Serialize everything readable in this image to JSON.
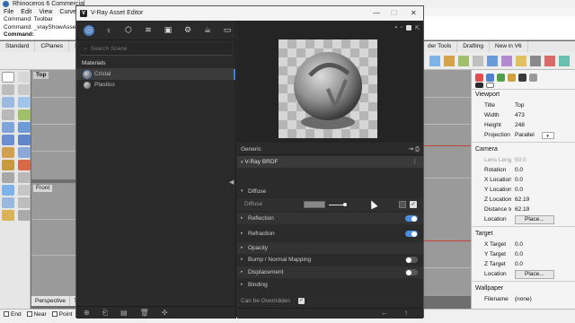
{
  "rhino": {
    "title": "Rhinoceros 6 Commercial",
    "menu": [
      "File",
      "Edit",
      "View",
      "Curve"
    ],
    "commands": [
      "Command: Toolbar",
      "Command: _vrayShowAsset",
      "Command:"
    ],
    "tabs": [
      "Standard",
      "CPlanes",
      "Se"
    ],
    "tabs_right": [
      "der Tools",
      "Drafting",
      "New in V6"
    ],
    "viewport_top": "Top",
    "viewport_front": "Front",
    "viewport_tabs": [
      "Perspective",
      "To"
    ],
    "osnap": [
      "End",
      "Near",
      "Point"
    ]
  },
  "properties": {
    "viewport_section": "Viewport",
    "viewport_rows": [
      {
        "k": "Title",
        "v": "Top"
      },
      {
        "k": "Width",
        "v": "473"
      },
      {
        "k": "Height",
        "v": "248"
      },
      {
        "k": "Projection",
        "v": "Parallel"
      }
    ],
    "camera_section": "Camera",
    "camera_rows": [
      {
        "k": "Lens Length",
        "v": "50.0"
      },
      {
        "k": "Rotation",
        "v": "0.0"
      },
      {
        "k": "X Location",
        "v": "0.0"
      },
      {
        "k": "Y Location",
        "v": "0.0"
      },
      {
        "k": "Z Location",
        "v": "62.19"
      },
      {
        "k": "Distance to ...",
        "v": "62.19"
      },
      {
        "k": "Location",
        "v": "Place..."
      }
    ],
    "target_section": "Target",
    "target_rows": [
      {
        "k": "X Target",
        "v": "0.0"
      },
      {
        "k": "Y Target",
        "v": "0.0"
      },
      {
        "k": "Z Target",
        "v": "0.0"
      },
      {
        "k": "Location",
        "v": "Place..."
      }
    ],
    "wallpaper_section": "Wallpaper",
    "wallpaper_rows": [
      {
        "k": "Filename",
        "v": "(none)"
      }
    ]
  },
  "vray": {
    "title": "V-Ray Asset Editor",
    "search_placeholder": "Search Scene",
    "materials_header": "Materials",
    "materials": [
      {
        "name": "Cristal",
        "selected": true
      },
      {
        "name": "Plastico",
        "selected": false
      }
    ],
    "generic_label": "Generic",
    "brdf_label": "V-Ray BRDF",
    "diffuse_section": "Diffuse",
    "diffuse_label": "Diffuse",
    "sections": [
      {
        "label": "Reflection",
        "toggle": "on"
      },
      {
        "label": "Refraction",
        "toggle": "on"
      },
      {
        "label": "Opacity",
        "toggle": "none"
      },
      {
        "label": "Bump / Normal Mapping",
        "toggle": "off"
      },
      {
        "label": "Displacement",
        "toggle": "off"
      },
      {
        "label": "Binding",
        "toggle": "none"
      }
    ],
    "override_label": "Can be Overridden",
    "colors": {
      "accent": "#4c8ee0",
      "panel": "#2b2b2b",
      "selection": "#3d7edc"
    }
  }
}
